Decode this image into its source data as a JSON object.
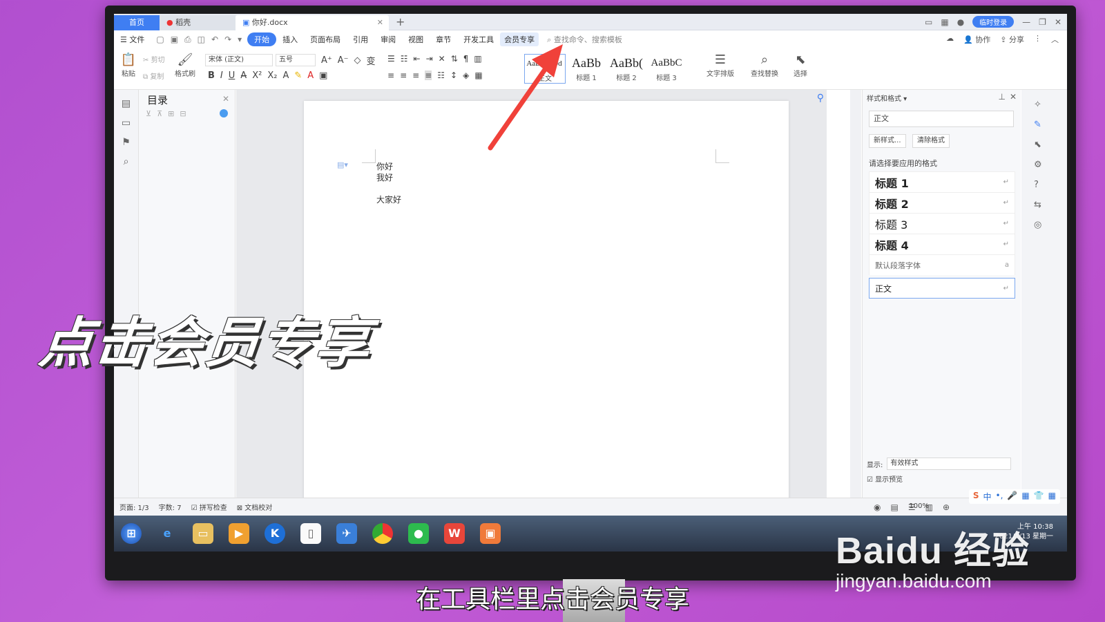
{
  "tabs": {
    "home": "首页",
    "daoke": "稻壳",
    "doc": "你好.docx"
  },
  "titlebar": {
    "login": "临时登录"
  },
  "menu": {
    "file": "文件",
    "items": [
      "开始",
      "插入",
      "页面布局",
      "引用",
      "审阅",
      "视图",
      "章节",
      "开发工具",
      "会员专享"
    ],
    "search": "查找命令、搜索模板",
    "collab": "协作",
    "share": "分享"
  },
  "ribbon": {
    "paste": "粘贴",
    "cut": "剪切",
    "copy": "复制",
    "format_painter": "格式刷",
    "font": "宋体 (正文)",
    "size": "五号",
    "styles": [
      {
        "preview": "AaBbCcDd",
        "label": "正文"
      },
      {
        "preview": "AaBb",
        "label": "标题 1"
      },
      {
        "preview": "AaBb(",
        "label": "标题 2"
      },
      {
        "preview": "AaBbC",
        "label": "标题 3"
      }
    ],
    "text_layout": "文字排版",
    "find_replace": "查找替换",
    "select": "选择"
  },
  "toc": {
    "title": "目录"
  },
  "document": {
    "lines": [
      "你好",
      "我好",
      "大家好"
    ]
  },
  "style_panel": {
    "title": "样式和格式",
    "current": "正文",
    "new_style": "新样式...",
    "clear_format": "清除格式",
    "hint": "请选择要应用的格式",
    "items": [
      "标题 1",
      "标题 2",
      "标题 3",
      "标题 4"
    ],
    "default_font": "默认段落字体",
    "selected": "正文",
    "show_label": "显示:",
    "show_value": "有效样式",
    "preview": "显示预览"
  },
  "status": {
    "page": "页面: 1/3",
    "words": "字数: 7",
    "spell": "拼写检查",
    "proof": "文档校对",
    "zoom": "100%"
  },
  "tray": {
    "time": "上午 10:38",
    "date": "2021/1/13 星期一"
  },
  "overlay": {
    "caption": "点击会员专享",
    "subtitle": "在工具栏里点击会员专享",
    "brand": "Baidu 经验",
    "url": "jingyan.baidu.com"
  },
  "colors": {
    "accent": "#3f7ef2",
    "arrow": "#f0413a",
    "background": "#c25fd8"
  }
}
